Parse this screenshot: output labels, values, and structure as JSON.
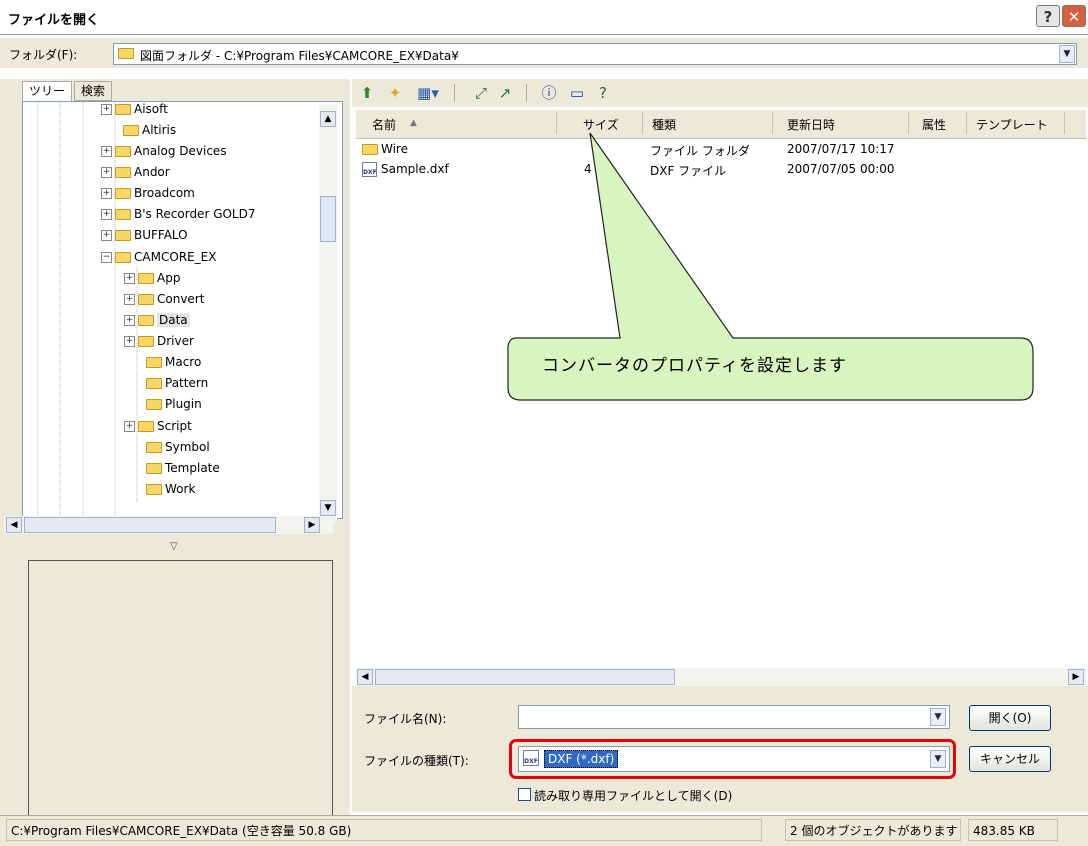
{
  "window": {
    "title": "ファイルを開く",
    "help": "?",
    "close": "✕"
  },
  "folder": {
    "label": "フォルダ(F):",
    "path": "図面フォルダ - C:¥Program Files¥CAMCORE_EX¥Data¥"
  },
  "tabs": {
    "tree": "ツリー",
    "search": "検索"
  },
  "tree": {
    "items": [
      {
        "label": "Aisoft",
        "expander": "+"
      },
      {
        "label": "Altiris",
        "expander": ""
      },
      {
        "label": "Analog Devices",
        "expander": "+"
      },
      {
        "label": "Andor",
        "expander": "+"
      },
      {
        "label": "Broadcom",
        "expander": "+"
      },
      {
        "label": "B's Recorder GOLD7",
        "expander": "+"
      },
      {
        "label": "BUFFALO",
        "expander": "+"
      },
      {
        "label": "CAMCORE_EX",
        "expander": "−"
      },
      {
        "label": "App",
        "expander": "+"
      },
      {
        "label": "Convert",
        "expander": "+"
      },
      {
        "label": "Data",
        "expander": "+"
      },
      {
        "label": "Driver",
        "expander": "+"
      },
      {
        "label": "Macro",
        "expander": ""
      },
      {
        "label": "Pattern",
        "expander": ""
      },
      {
        "label": "Plugin",
        "expander": ""
      },
      {
        "label": "Script",
        "expander": "+"
      },
      {
        "label": "Symbol",
        "expander": ""
      },
      {
        "label": "Template",
        "expander": ""
      },
      {
        "label": "Work",
        "expander": ""
      }
    ]
  },
  "list": {
    "columns": {
      "name": "名前",
      "size": "サイズ",
      "type": "種類",
      "modified": "更新日時",
      "attr": "属性",
      "template": "テンプレート"
    },
    "rows": [
      {
        "name": "Wire",
        "size": "",
        "type": "ファイル フォルダ",
        "modified": "2007/07/17 10:17"
      },
      {
        "name": "Sample.dxf",
        "size": "4",
        "type": "DXF ファイル",
        "modified": "2007/07/05 00:00"
      }
    ]
  },
  "form": {
    "filename_label": "ファイル名(N):",
    "filename_value": "",
    "filetype_label": "ファイルの種類(T):",
    "filetype_value": "DXF (*.dxf)",
    "readonly_label": "読み取り専用ファイルとして開く(D)",
    "open_button": "開く(O)",
    "cancel_button": "キャンセル"
  },
  "status": {
    "path": "C:¥Program Files¥CAMCORE_EX¥Data (空き容量 50.8 GB)",
    "count": "2 個のオブジェクトがあります",
    "size": "483.85 KB"
  },
  "callout": {
    "text": "コンバータのプロパティを設定します"
  },
  "colors": {
    "highlight": "#e8000b",
    "callout_fill": "#d8f5c0"
  }
}
